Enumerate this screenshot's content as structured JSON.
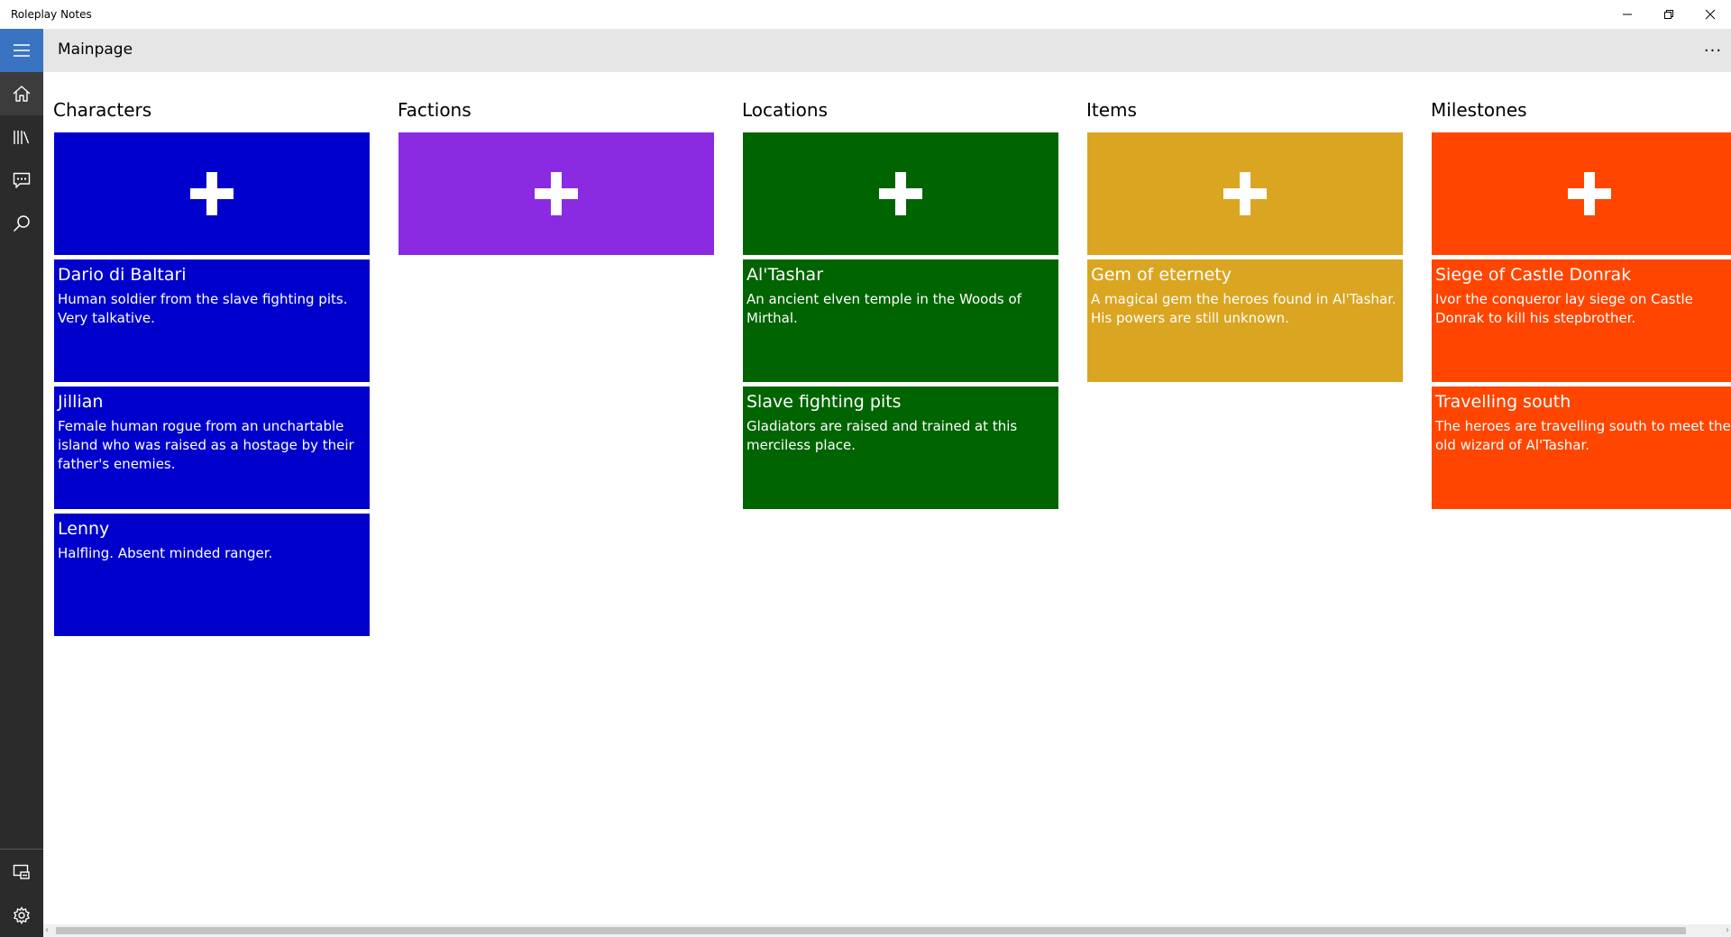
{
  "app": {
    "title": "Roleplay Notes"
  },
  "window_controls": {
    "minimize": "minimize-icon",
    "restore": "restore-icon",
    "close": "close-icon"
  },
  "nav": {
    "top_icons": [
      "hamburger-icon",
      "home-icon",
      "library-icon",
      "comment-icon",
      "search-icon"
    ],
    "bottom_icons": [
      "present-icon",
      "gear-icon"
    ],
    "accent": "#3b73c3"
  },
  "header": {
    "title": "Mainpage",
    "more": "···"
  },
  "columns": [
    {
      "heading": "Characters",
      "color": "#0000cd",
      "tiles": [
        {
          "name": "Dario di Baltari",
          "desc": "Human soldier from the slave fighting pits. Very talkative."
        },
        {
          "name": "Jillian",
          "desc": "Female human rogue from an unchartable island who was raised as a hostage by their father's enemies."
        },
        {
          "name": "Lenny",
          "desc": "Halfling. Absent minded ranger."
        }
      ]
    },
    {
      "heading": "Factions",
      "color": "#8a2be2",
      "tiles": []
    },
    {
      "heading": "Locations",
      "color": "#006400",
      "tiles": [
        {
          "name": "Al'Tashar",
          "desc": "An ancient elven temple in the Woods of Mirthal."
        },
        {
          "name": "Slave fighting pits",
          "desc": "Gladiators are raised and trained at this merciless place."
        }
      ]
    },
    {
      "heading": "Items",
      "color": "#daa520",
      "tiles": [
        {
          "name": "Gem of eternety",
          "desc": "A magical gem the heroes found in Al'Tashar. His powers are still unknown."
        }
      ]
    },
    {
      "heading": "Milestones",
      "color": "#ff4500",
      "tiles": [
        {
          "name": "Siege of Castle Donrak",
          "desc": "Ivor the conqueror lay siege on Castle Donrak to kill his stepbrother."
        },
        {
          "name": "Travelling south",
          "desc": "The heroes are travelling south to meet the old wizard of Al'Tashar."
        }
      ]
    }
  ]
}
